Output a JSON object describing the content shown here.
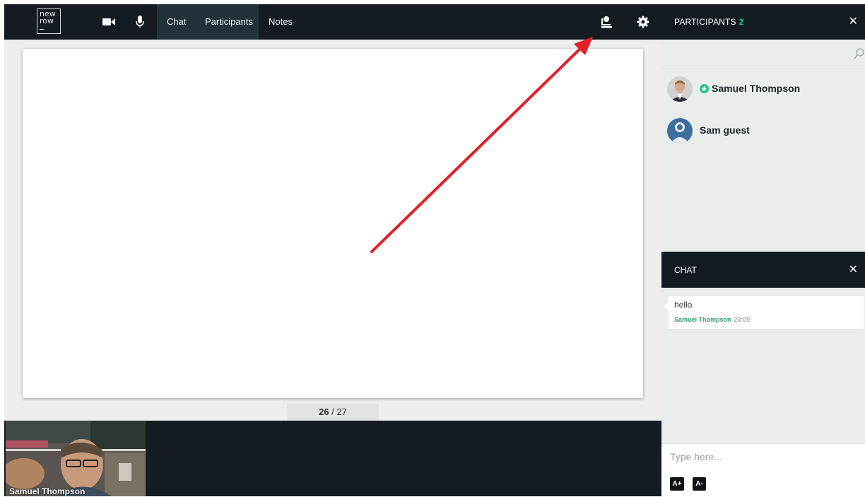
{
  "toolbar": {
    "logo": {
      "line1": "new",
      "line2": "row"
    },
    "tabs": [
      {
        "label": "Chat",
        "active": true
      },
      {
        "label": "Participants",
        "active": true
      },
      {
        "label": "Notes",
        "active": false
      }
    ],
    "icons": [
      "video-camera-icon",
      "microphone-icon",
      "presenter-icon",
      "gear-icon"
    ]
  },
  "presentation": {
    "current_page": "26",
    "page_separator": "/",
    "total_pages": "27"
  },
  "annotation": {
    "arrow_color": "#e41e26"
  },
  "video": {
    "participant_name": "Samuel Thompson"
  },
  "participants_panel": {
    "title": "PARTICIPANTS",
    "count": "2",
    "close_label": "✕",
    "search_placeholder": "",
    "participants": [
      {
        "name": "Samuel Thompson",
        "is_host": true
      },
      {
        "name": "Sam guest",
        "is_host": false
      }
    ]
  },
  "chat_panel": {
    "title": "CHAT",
    "close_label": "✕",
    "messages": [
      {
        "text": "hello",
        "author": "Samuel Thompson",
        "time": "20:09"
      }
    ],
    "input_placeholder": "Type here...",
    "font_increase_label": "A+",
    "font_decrease_label": "A-"
  },
  "colors": {
    "topbar_bg": "#141c21",
    "active_tab_bg": "#22313a",
    "accent_green": "#2fbf8a",
    "author_green": "#3a9b6f",
    "panel_bg": "#e9edec"
  }
}
